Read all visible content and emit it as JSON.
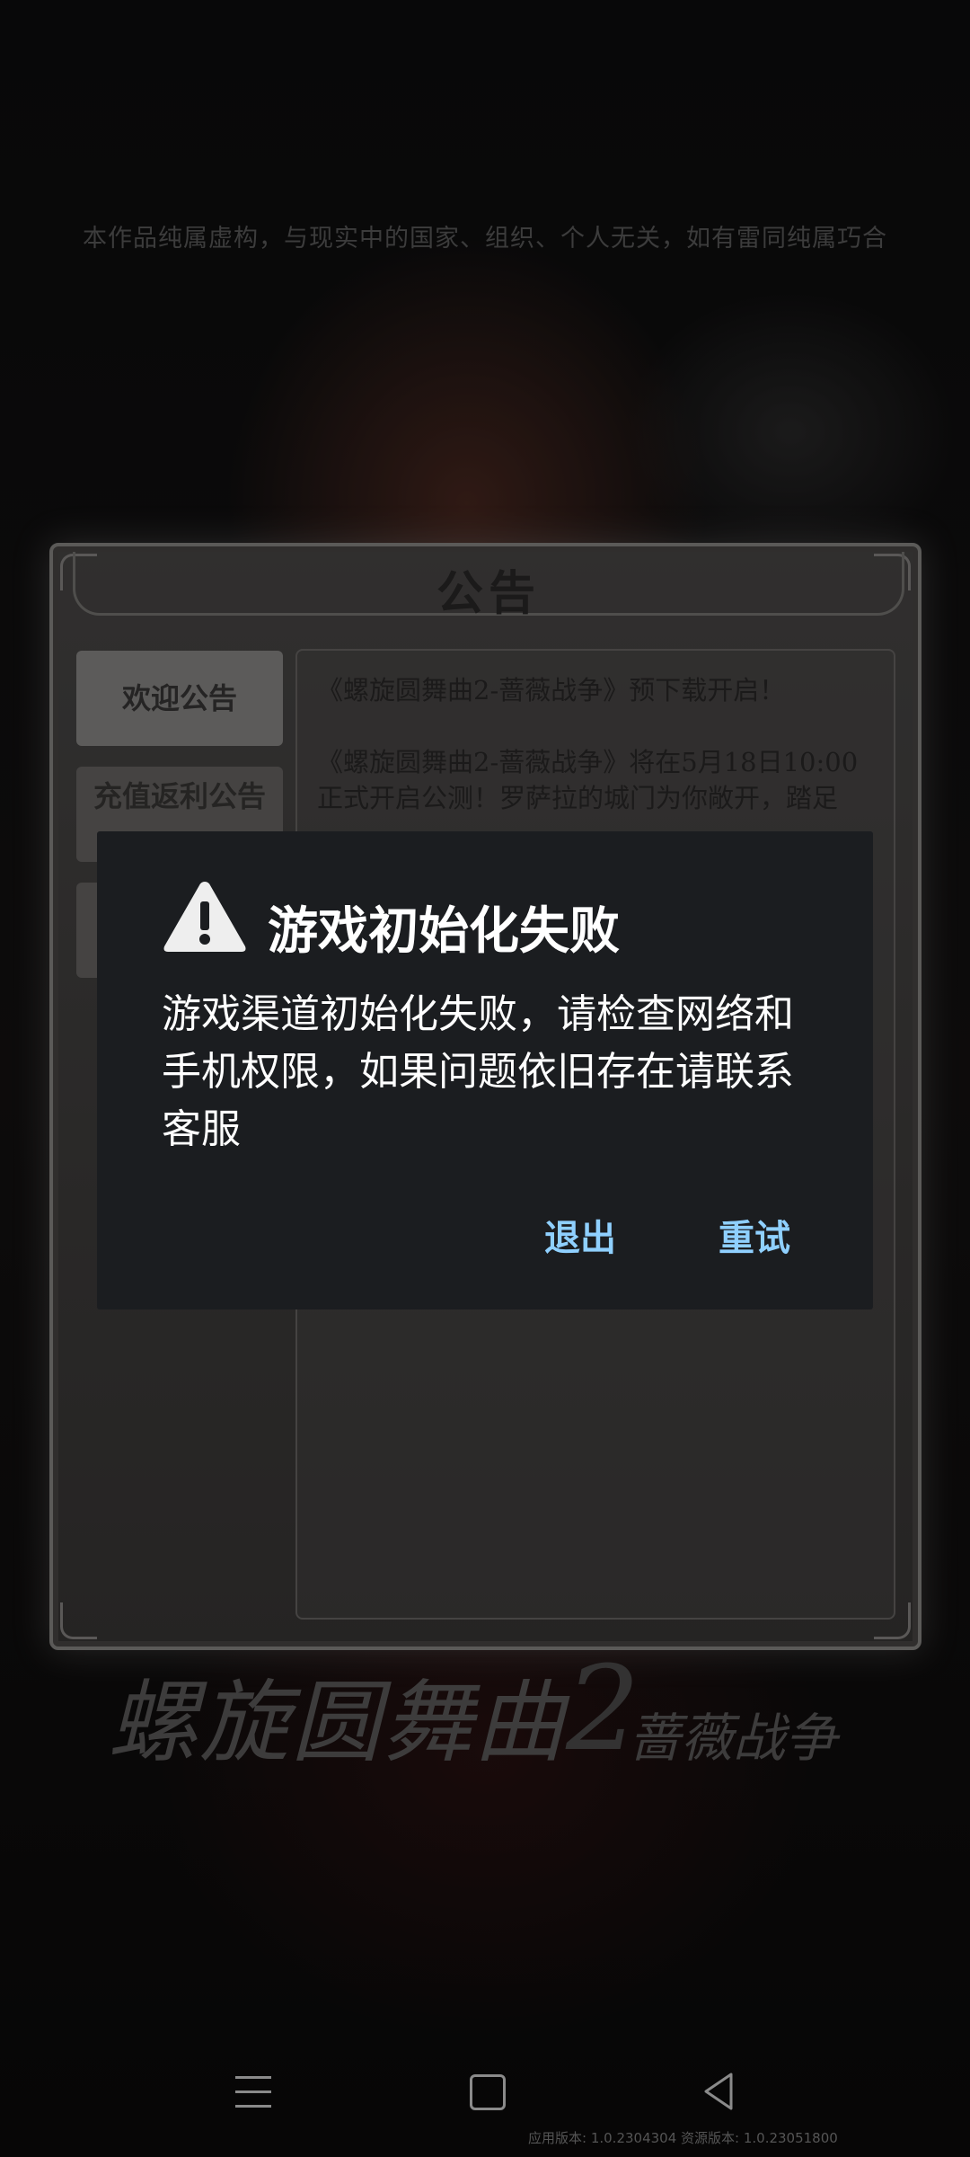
{
  "disclaimer": "本作品纯属虚构，与现实中的国家、组织、个人无关，如有雷同纯属巧合",
  "notice": {
    "title": "公告",
    "tabs": [
      {
        "label": "欢迎公告",
        "active": true
      },
      {
        "label": "充值返利公告",
        "active": false
      },
      {
        "label": "",
        "active": false
      }
    ],
    "content": [
      "《螺旋圆舞曲2-蔷薇战争》预下载开启！",
      "《螺旋圆舞曲2-蔷薇战争》将在5月18日10:00正式开启公测！罗萨拉的城门为你敞开，踏足"
    ]
  },
  "logo": {
    "main": "螺旋圆舞曲",
    "number": "2",
    "subtitle": "蔷薇战争"
  },
  "dialog": {
    "title": "游戏初始化失败",
    "message": "游戏渠道初始化失败，请检查网络和手机权限，如果问题依旧存在请联系客服",
    "exit_label": "退出",
    "retry_label": "重试"
  },
  "version": "应用版本: 1.0.2304304 资源版本: 1.0.23051800",
  "colors": {
    "dialog_bg": "#1b1d20",
    "dialog_button": "#8fd0ff",
    "panel_bg": "#4b4948"
  }
}
